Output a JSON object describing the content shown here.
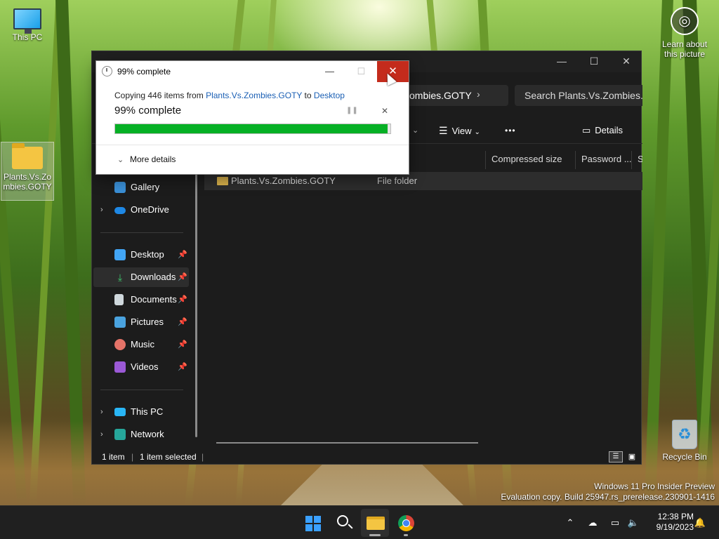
{
  "desktop": {
    "icons": [
      {
        "label": "This PC"
      },
      {
        "label": "Plants.Vs.Zombies.GOTY"
      },
      {
        "label": "Recycle Bin"
      }
    ],
    "learn_about": "Learn about this picture",
    "watermark_line1": "Windows 11 Pro Insider Preview",
    "watermark_line2": "Evaluation copy. Build 25947.rs_prerelease.230901-1416"
  },
  "explorer": {
    "address_crumb": "zombies.GOTY",
    "search_placeholder": "Search Plants.Vs.Zombies.G",
    "toolbar": {
      "view_label": "View",
      "more_label": "•••",
      "details_label": "Details"
    },
    "columns": [
      "Compressed size",
      "Password ...",
      "Si"
    ],
    "rows": [
      {
        "name": "Plants.Vs.Zombies.GOTY",
        "type": "File folder"
      }
    ],
    "nav": [
      {
        "label": "Gallery"
      },
      {
        "label": "OneDrive"
      },
      {
        "label": "Desktop"
      },
      {
        "label": "Downloads"
      },
      {
        "label": "Documents"
      },
      {
        "label": "Pictures"
      },
      {
        "label": "Music"
      },
      {
        "label": "Videos"
      },
      {
        "label": "This PC"
      },
      {
        "label": "Network"
      }
    ],
    "status": {
      "items": "1 item",
      "selected": "1 item selected"
    }
  },
  "dialog": {
    "title": "99% complete",
    "desc_prefix": "Copying 446 items from ",
    "source": "Plants.Vs.Zombies.GOTY",
    "desc_middle": " to ",
    "destination": "Desktop",
    "percent_text": "99% complete",
    "progress": 0.99,
    "more_details": "More details",
    "progress_color": "#06b025",
    "close_color": "#c42b1c"
  },
  "taskbar": {
    "time": "12:38 PM",
    "date": "9/19/2023",
    "apps": [
      "start-icon",
      "search-icon",
      "file-explorer-icon",
      "chrome-icon"
    ]
  }
}
